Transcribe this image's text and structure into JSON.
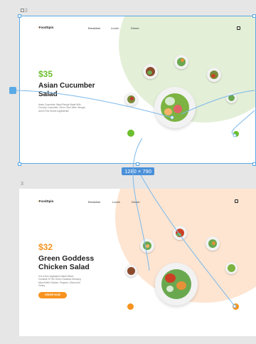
{
  "frames": [
    {
      "number": "2",
      "brand": "FoodSpin",
      "nav": [
        "Breakfast",
        "Lunch",
        "Dinner"
      ],
      "price": "$35",
      "title_line1": "Asian Cucumber",
      "title_line2": "Salad",
      "description": "Asian Cucumber Salad Recipe Made With Crunchy Cucumber, Onion, Rice Wine Vinegar, And A Few Secret Ingredients!",
      "accent": "#6bbf2c",
      "blob_color": "#e4efd8"
    },
    {
      "number": "3",
      "brand": "FoodSpin",
      "nav": [
        "Breakfast",
        "Lunch",
        "Dinner"
      ],
      "price": "$32",
      "title_line1": "Green Goddess",
      "title_line2": "Chicken Salad",
      "description": "It Is A Non Vegetarian Salad Which Consists Of The Green Goddess Dressing Mixed With Chicken, Peppers, Olives And Celery.",
      "cta": "ORDER NOW",
      "accent": "#f7931e",
      "blob_color": "#fde5d2"
    }
  ],
  "dimension_badge": "1280 × 790",
  "selection_color": "#5aa9e6"
}
